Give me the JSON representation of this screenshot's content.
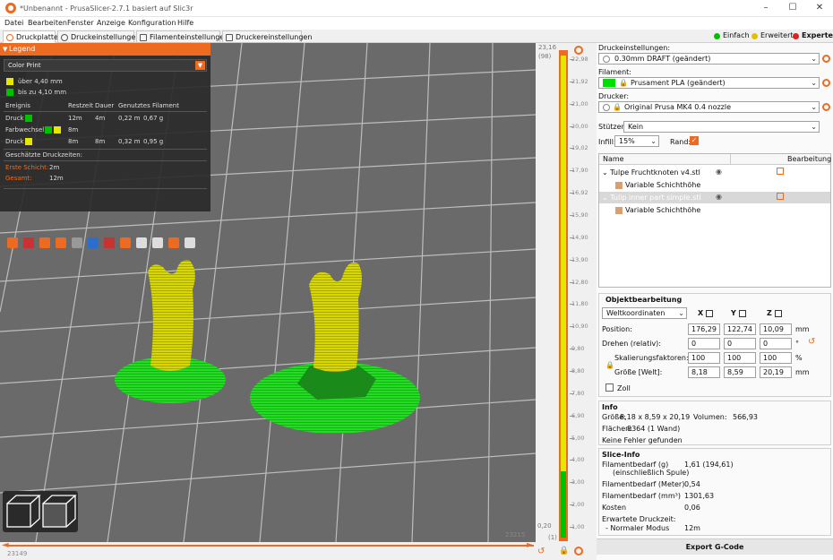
{
  "window": {
    "title": "*Unbenannt - PrusaSlicer-2.7.1 basiert auf Slic3r",
    "min": "–",
    "max": "☐",
    "close": "✕"
  },
  "menu": [
    "Datei",
    "Bearbeiten",
    "Fenster",
    "Anzeige",
    "Konfiguration",
    "Hilfe"
  ],
  "tabs": [
    "Druckplatte",
    "Druckeinstellungen",
    "Filamenteinstellungen",
    "Druckereinstellungen"
  ],
  "modes": [
    {
      "label": "Einfach",
      "color": "#00c000"
    },
    {
      "label": "Erweitert",
      "color": "#e0c000"
    },
    {
      "label": "Experte",
      "color": "#e02020"
    }
  ],
  "legend": {
    "header": "Legend",
    "view_type": "Color Print",
    "ranges": [
      {
        "label": "über 4,40 mm",
        "color": "#e6e600"
      },
      {
        "label": "bis zu 4,10 mm",
        "color": "#00c000"
      }
    ],
    "columns": [
      "Ereignis",
      "Restzeit",
      "Dauer",
      "Genutztes Filament"
    ],
    "events": [
      {
        "name": "Druck",
        "remaining": "12m",
        "duration": "4m",
        "used_mm": "0,22 m",
        "used_g": "0,67 g"
      },
      {
        "name": "Farbwechsel",
        "remaining": "8m",
        "duration": "",
        "used_mm": "",
        "used_g": ""
      },
      {
        "name": "Druck",
        "remaining": "8m",
        "duration": "8m",
        "used_mm": "0,32 m",
        "used_g": "0,95 g"
      }
    ],
    "estimated_title": "Geschätzte Druckzeiten:",
    "first_layer_label": "Erste Schicht:",
    "first_layer_value": "2m",
    "total_label": "Gesamt:",
    "total_value": "12m"
  },
  "horizontal_slider": {
    "left_value": "23149",
    "right_value": "23215"
  },
  "vertical_slider": {
    "top_value": "23,16",
    "top_layer": "(98)",
    "bottom_value": "0,20",
    "bottom_layer": "(1)",
    "ticks": [
      "22,98",
      "21,92",
      "21,00",
      "20,00",
      "19,02",
      "17,90",
      "16,92",
      "15,90",
      "14,90",
      "13,90",
      "12,80",
      "11,80",
      "10,90",
      "9,80",
      "8,80",
      "7,80",
      "6,90",
      "5,00",
      "4,00",
      "3,00",
      "2,00",
      "1,00"
    ]
  },
  "settings": {
    "print_label": "Druckeinstellungen:",
    "print_value": "0.30mm DRAFT (geändert)",
    "filament_label": "Filament:",
    "filament_value": "Prusament PLA (geändert)",
    "filament_color": "#00e000",
    "printer_label": "Drucker:",
    "printer_value": "Original Prusa MK4 0.4 nozzle",
    "supports_label": "Stützen:",
    "supports_value": "Kein",
    "infill_label": "Infill:",
    "infill_value": "15%",
    "brim_label": "Rand:"
  },
  "object_list": {
    "col_name": "Name",
    "col_edit": "Bearbeitung",
    "items": [
      {
        "name": "Tulpe Fruchtknoten v4.stl",
        "selected": false
      },
      {
        "name": "Variable Schichthöhe",
        "sub": true
      },
      {
        "name": "Tulip inner part simple.stl",
        "selected": true
      },
      {
        "name": "Variable Schichthöhe",
        "sub": true
      }
    ]
  },
  "object_manip": {
    "title": "Objektbearbeitung",
    "coord_system": "Weltkoordinaten",
    "axes": [
      "X",
      "Y",
      "Z"
    ],
    "position_label": "Position:",
    "position": [
      "176,29",
      "122,74",
      "10,09"
    ],
    "position_unit": "mm",
    "rotation_label": "Drehen (relativ):",
    "rotation": [
      "0",
      "0",
      "0"
    ],
    "rotation_unit": "°",
    "scale_label": "Skalierungsfaktoren:",
    "scale": [
      "100",
      "100",
      "100"
    ],
    "scale_unit": "%",
    "size_label": "Größe [Welt]:",
    "size": [
      "8,18",
      "8,59",
      "20,19"
    ],
    "size_unit": "mm",
    "inch_label": "Zoll"
  },
  "info": {
    "title": "Info",
    "size_label": "Größe:",
    "size_value": "8,18 x 8,59 x 20,19",
    "volume_label": "Volumen:",
    "volume_value": "566,93",
    "facets_label": "Flächen:",
    "facets_value": "8364 (1 Wand)",
    "errors": "Keine Fehler gefunden"
  },
  "slice_info": {
    "title": "Slice-Info",
    "filament_g_label": "Filamentbedarf (g)",
    "filament_g_sub": "(einschließlich Spule)",
    "filament_g_value": "1,61 (194,61)",
    "filament_m_label": "Filamentbedarf (Meter)",
    "filament_m_value": "0,54",
    "filament_mm3_label": "Filamentbedarf (mm³)",
    "filament_mm3_value": "1301,63",
    "cost_label": "Kosten",
    "cost_value": "0,06",
    "time_label": "Erwartete Druckzeit:",
    "mode_label": "- Normaler Modus",
    "mode_value": "12m"
  },
  "export_button": "Export G-Code"
}
